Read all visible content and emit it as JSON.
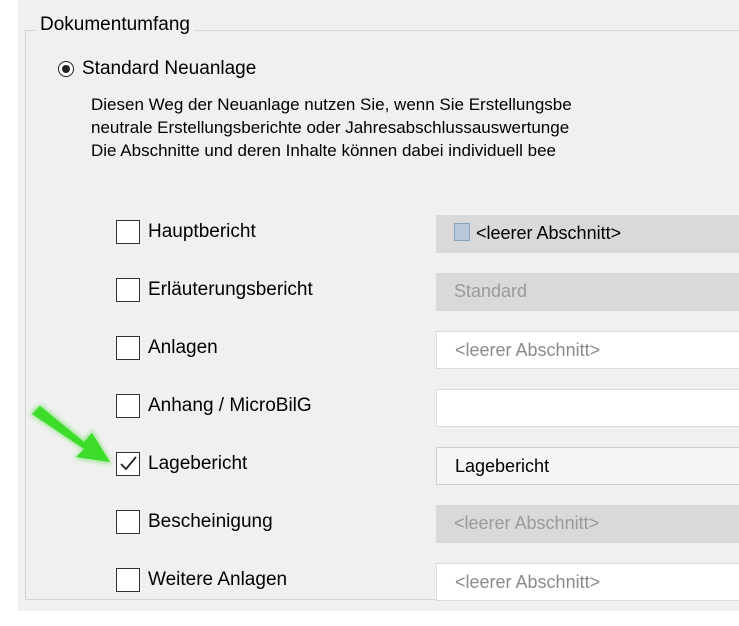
{
  "group": {
    "title": "Dokumentumfang",
    "option": {
      "label": "Standard Neuanlage",
      "selected": true
    },
    "description": [
      "Diesen Weg der Neuanlage nutzen Sie, wenn Sie Erstellungsbe",
      "neutrale Erstellungsberichte oder Jahresabschlussauswertunge",
      "Die Abschnitte und deren Inhalte können dabei individuell bee"
    ]
  },
  "rows": [
    {
      "label": "Hauptbericht",
      "checked": false,
      "value": "<leerer Abschnitt>",
      "style": "dark",
      "icon": "section-icon"
    },
    {
      "label": "Erläuterungsbericht",
      "checked": false,
      "value": "Standard",
      "style": "gray"
    },
    {
      "label": "Anlagen",
      "checked": false,
      "value": "<leerer Abschnitt>",
      "style": "white"
    },
    {
      "label": "Anhang / MicroBilG",
      "checked": false,
      "value": "",
      "style": "white"
    },
    {
      "label": "Lagebericht",
      "checked": true,
      "value": "Lagebericht",
      "style": "dark"
    },
    {
      "label": "Bescheinigung",
      "checked": false,
      "value": "<leerer Abschnitt>",
      "style": "gray"
    },
    {
      "label": "Weitere Anlagen",
      "checked": false,
      "value": "<leerer Abschnitt>",
      "style": "white"
    }
  ],
  "annotation": {
    "arrow_color": "#3ddc2a"
  }
}
